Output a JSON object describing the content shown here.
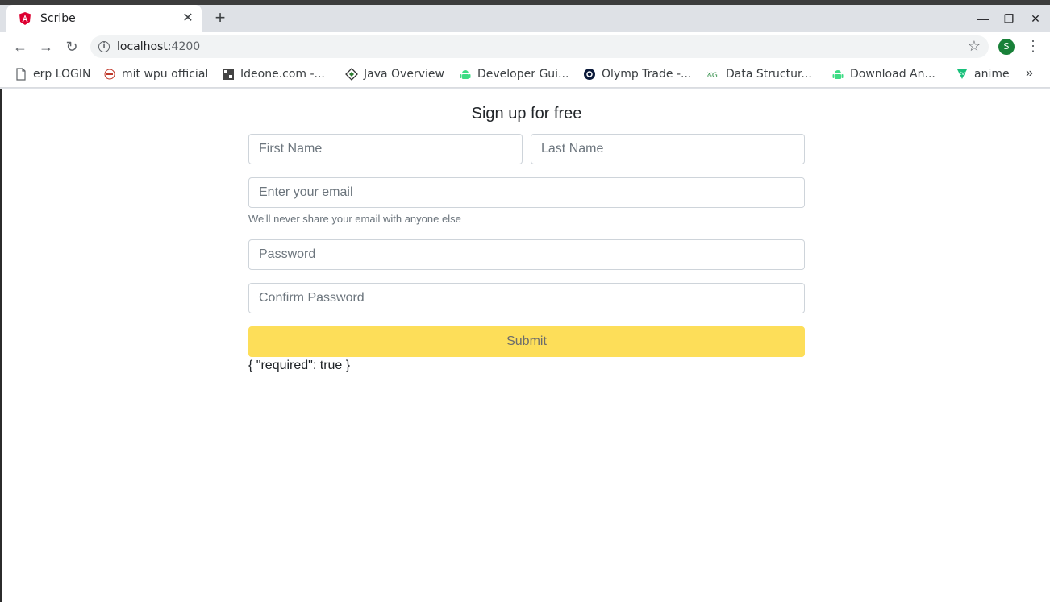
{
  "browser": {
    "tab": {
      "title": "Scribe",
      "icon": "angular-icon"
    },
    "window_controls": {
      "minimize": "—",
      "restore": "❐",
      "close": "✕"
    },
    "url_host": "localhost",
    "url_port": ":4200",
    "profile_initial": "S",
    "bookmarks": [
      {
        "label": "erp LOGIN",
        "icon": "page-icon"
      },
      {
        "label": "mit wpu official",
        "icon": "mitwpu-icon"
      },
      {
        "label": "Ideone.com -...",
        "icon": "ideone-icon"
      },
      {
        "label": "Java Overview",
        "icon": "java-icon"
      },
      {
        "label": "Developer Gui...",
        "icon": "android-icon"
      },
      {
        "label": "Olymp Trade -...",
        "icon": "olymp-icon"
      },
      {
        "label": "Data Structur...",
        "icon": "geeksforgeeks-icon"
      },
      {
        "label": "Download An...",
        "icon": "android-icon"
      },
      {
        "label": "anime",
        "icon": "anime-icon"
      }
    ]
  },
  "form": {
    "title": "Sign up for free",
    "first_name_placeholder": "First Name",
    "last_name_placeholder": "Last Name",
    "email_placeholder": "Enter your email",
    "email_help": "We'll never share your email with anyone else",
    "password_placeholder": "Password",
    "confirm_password_placeholder": "Confirm Password",
    "submit_label": "Submit",
    "debug_output": "{ \"required\": true }"
  },
  "colors": {
    "submit_bg": "#fdde59",
    "tab_bar": "#dee1e6",
    "profile_bg": "#188038"
  }
}
